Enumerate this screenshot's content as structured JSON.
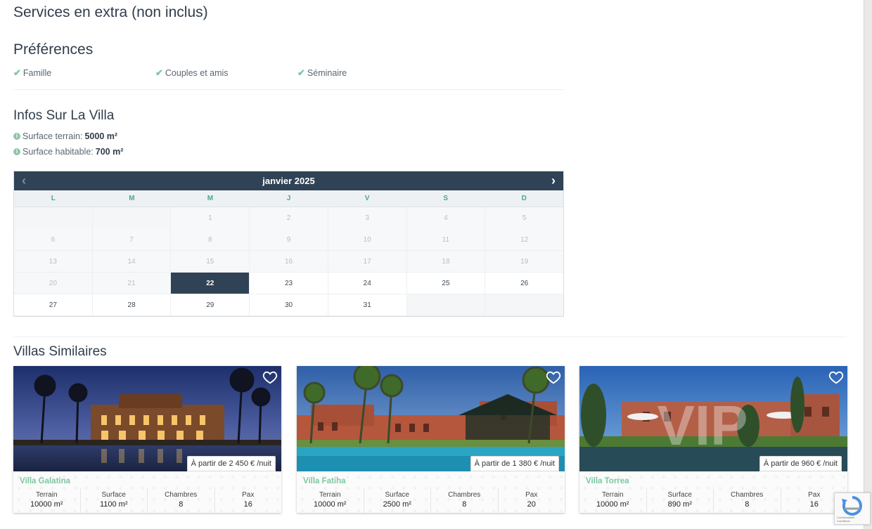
{
  "sections": {
    "extra_title": "Services en extra (non inclus)",
    "preferences_title": "Préférences",
    "infos_title": "Infos Sur La Villa",
    "similar_title": "Villas Similaires"
  },
  "preferences": [
    "Famille",
    "Couples et amis",
    "Séminaire"
  ],
  "infos": [
    {
      "label": "Surface terrain:",
      "value": "5000 m²"
    },
    {
      "label": "Surface habitable:",
      "value": "700 m²"
    }
  ],
  "calendar": {
    "month_label": "janvier 2025",
    "weekdays": [
      "L",
      "M",
      "M",
      "J",
      "V",
      "S",
      "D"
    ],
    "today": 22
  },
  "villas": [
    {
      "name": "Villa Galatina",
      "price": "À partir de 2 450 € /nuit",
      "terrain": "10000 m²",
      "surface": "1100 m²",
      "chambres": "8",
      "pax": "16"
    },
    {
      "name": "Villa Fatiha",
      "price": "À partir de 1 380 € /nuit",
      "terrain": "10000 m²",
      "surface": "2500 m²",
      "chambres": "8",
      "pax": "20"
    },
    {
      "name": "Villa Torrea",
      "price": "À partir de 960 € /nuit",
      "terrain": "10000 m²",
      "surface": "890 m²",
      "chambres": "8",
      "pax": "16"
    }
  ],
  "stat_labels": {
    "terrain": "Terrain",
    "surface": "Surface",
    "chambres": "Chambres",
    "pax": "Pax"
  },
  "recaptcha_text": "Confidentialité - Conditions",
  "colors": {
    "navy": "#2f4256",
    "accent_green": "#7cc8a0"
  }
}
